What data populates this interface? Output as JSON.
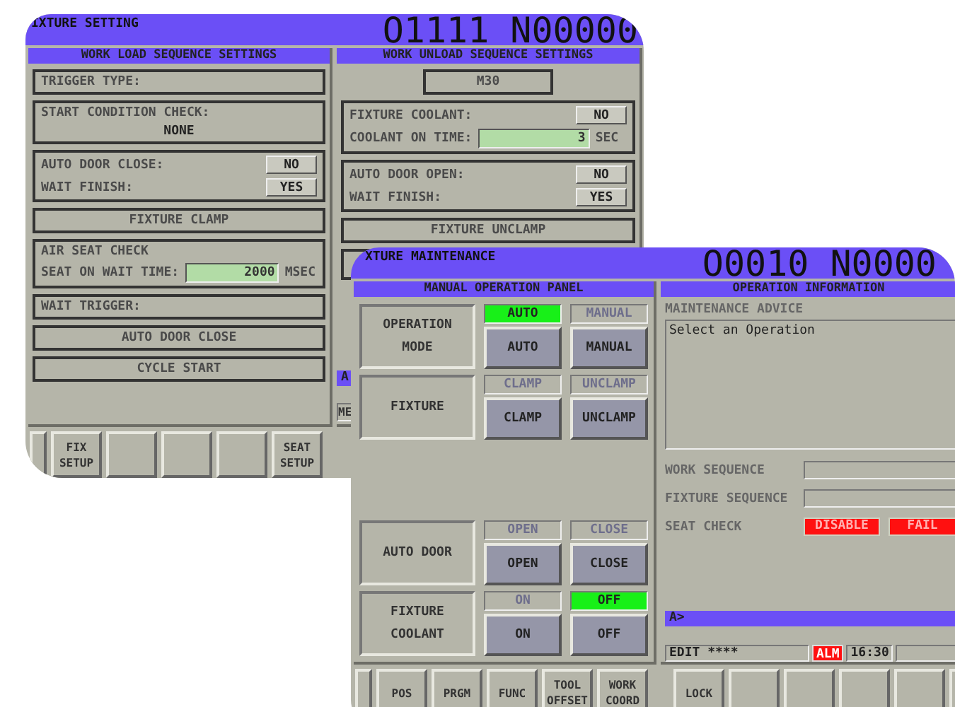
{
  "fixture_setting": {
    "title": "IXTURE SETTING",
    "program": "O1111 N00000",
    "load_sequence": {
      "header": "WORK LOAD SEQUENCE SETTINGS",
      "steps": [
        {
          "kind": "box",
          "label": "TRIGGER TYPE:"
        },
        {
          "kind": "check",
          "label": "START CONDITION CHECK:",
          "value": "NONE"
        },
        {
          "kind": "group",
          "rows": [
            {
              "kind": "toggle",
              "label": "AUTO DOOR CLOSE:",
              "value": "NO"
            },
            {
              "kind": "toggle",
              "label": "WAIT FINISH:",
              "value": "YES"
            }
          ]
        },
        {
          "kind": "action",
          "label": "FIXTURE CLAMP"
        },
        {
          "kind": "group",
          "title": "AIR SEAT CHECK",
          "rows": [
            {
              "kind": "field",
              "label": "SEAT ON WAIT TIME:",
              "value": "2000",
              "unit": "MSEC"
            }
          ]
        },
        {
          "kind": "box",
          "label": "WAIT TRIGGER:"
        },
        {
          "kind": "action",
          "label": "AUTO DOOR CLOSE"
        },
        {
          "kind": "action",
          "label": "CYCLE START"
        }
      ]
    },
    "unload_sequence": {
      "header": "WORK UNLOAD SEQUENCE SETTINGS",
      "steps": [
        {
          "kind": "tag",
          "label": "M30"
        },
        {
          "kind": "group",
          "rows": [
            {
              "kind": "toggle",
              "label": "FIXTURE COOLANT:",
              "value": "NO"
            },
            {
              "kind": "field",
              "label": "COOLANT ON TIME:",
              "value": "3",
              "unit": "SEC"
            }
          ]
        },
        {
          "kind": "group",
          "rows": [
            {
              "kind": "toggle",
              "label": "AUTO DOOR OPEN:",
              "value": "NO"
            },
            {
              "kind": "toggle",
              "label": "WAIT FINISH:",
              "value": "YES"
            }
          ]
        },
        {
          "kind": "action",
          "label": "FIXTURE UNCLAMP"
        },
        {
          "kind": "blank"
        }
      ],
      "prompt": "A",
      "status": "ME"
    },
    "softkeys": [
      {
        "kind": "edge"
      },
      {
        "kind": "key",
        "label": "FIX SETUP"
      },
      {
        "kind": "key"
      },
      {
        "kind": "key"
      },
      {
        "kind": "key"
      },
      {
        "kind": "key",
        "label": "SEAT SETUP"
      }
    ]
  },
  "fixture_maintenance": {
    "title": "XTURE MAINTENANCE",
    "program": "O0010 N0000",
    "manual_panel": {
      "header": "MANUAL OPERATION PANEL",
      "groups": [
        {
          "rows": [
            {
              "label": "OPERATION MODE",
              "options": [
                {
                  "indicator": "AUTO",
                  "button": "AUTO",
                  "lit": true
                },
                {
                  "indicator": "MANUAL",
                  "button": "MANUAL",
                  "lit": false
                }
              ]
            },
            {
              "label": "FIXTURE",
              "options": [
                {
                  "indicator": "CLAMP",
                  "button": "CLAMP",
                  "lit": false
                },
                {
                  "indicator": "UNCLAMP",
                  "button": "UNCLAMP",
                  "lit": false
                }
              ]
            }
          ]
        },
        {
          "rows": [
            {
              "label": "AUTO DOOR",
              "options": [
                {
                  "indicator": "OPEN",
                  "button": "OPEN",
                  "lit": false
                },
                {
                  "indicator": "CLOSE",
                  "button": "CLOSE",
                  "lit": false
                }
              ]
            },
            {
              "label": "FIXTURE COOLANT",
              "options": [
                {
                  "indicator": "ON",
                  "button": "ON",
                  "lit": false
                },
                {
                  "indicator": "OFF",
                  "button": "OFF",
                  "lit": true
                }
              ]
            }
          ]
        }
      ]
    },
    "info_panel": {
      "header": "OPERATION INFORMATION",
      "advice_label": "MAINTENANCE ADVICE",
      "advice": "Select an Operation",
      "items": [
        {
          "kind": "field",
          "label": "WORK SEQUENCE"
        },
        {
          "kind": "field",
          "label": "FIXTURE SEQUENCE"
        },
        {
          "kind": "badges",
          "label": "SEAT CHECK",
          "badges": [
            "DISABLE",
            "FAIL"
          ]
        }
      ],
      "prompt": "A>",
      "mode": "EDIT ****",
      "alarm": "ALM",
      "alarm_on": true,
      "time": "16:30"
    },
    "softkeys": [
      {
        "kind": "edge"
      },
      {
        "kind": "key",
        "label": "POS"
      },
      {
        "kind": "key",
        "label": "PRGM"
      },
      {
        "kind": "key",
        "label": "FUNC"
      },
      {
        "kind": "key",
        "label": "TOOL OFFSET"
      },
      {
        "kind": "key",
        "label": "WORK COORD"
      },
      {
        "kind": "gap"
      },
      {
        "kind": "key",
        "label": "LOCK"
      },
      {
        "kind": "key"
      },
      {
        "kind": "key"
      },
      {
        "kind": "key"
      },
      {
        "kind": "key"
      },
      {
        "kind": "key"
      }
    ]
  }
}
